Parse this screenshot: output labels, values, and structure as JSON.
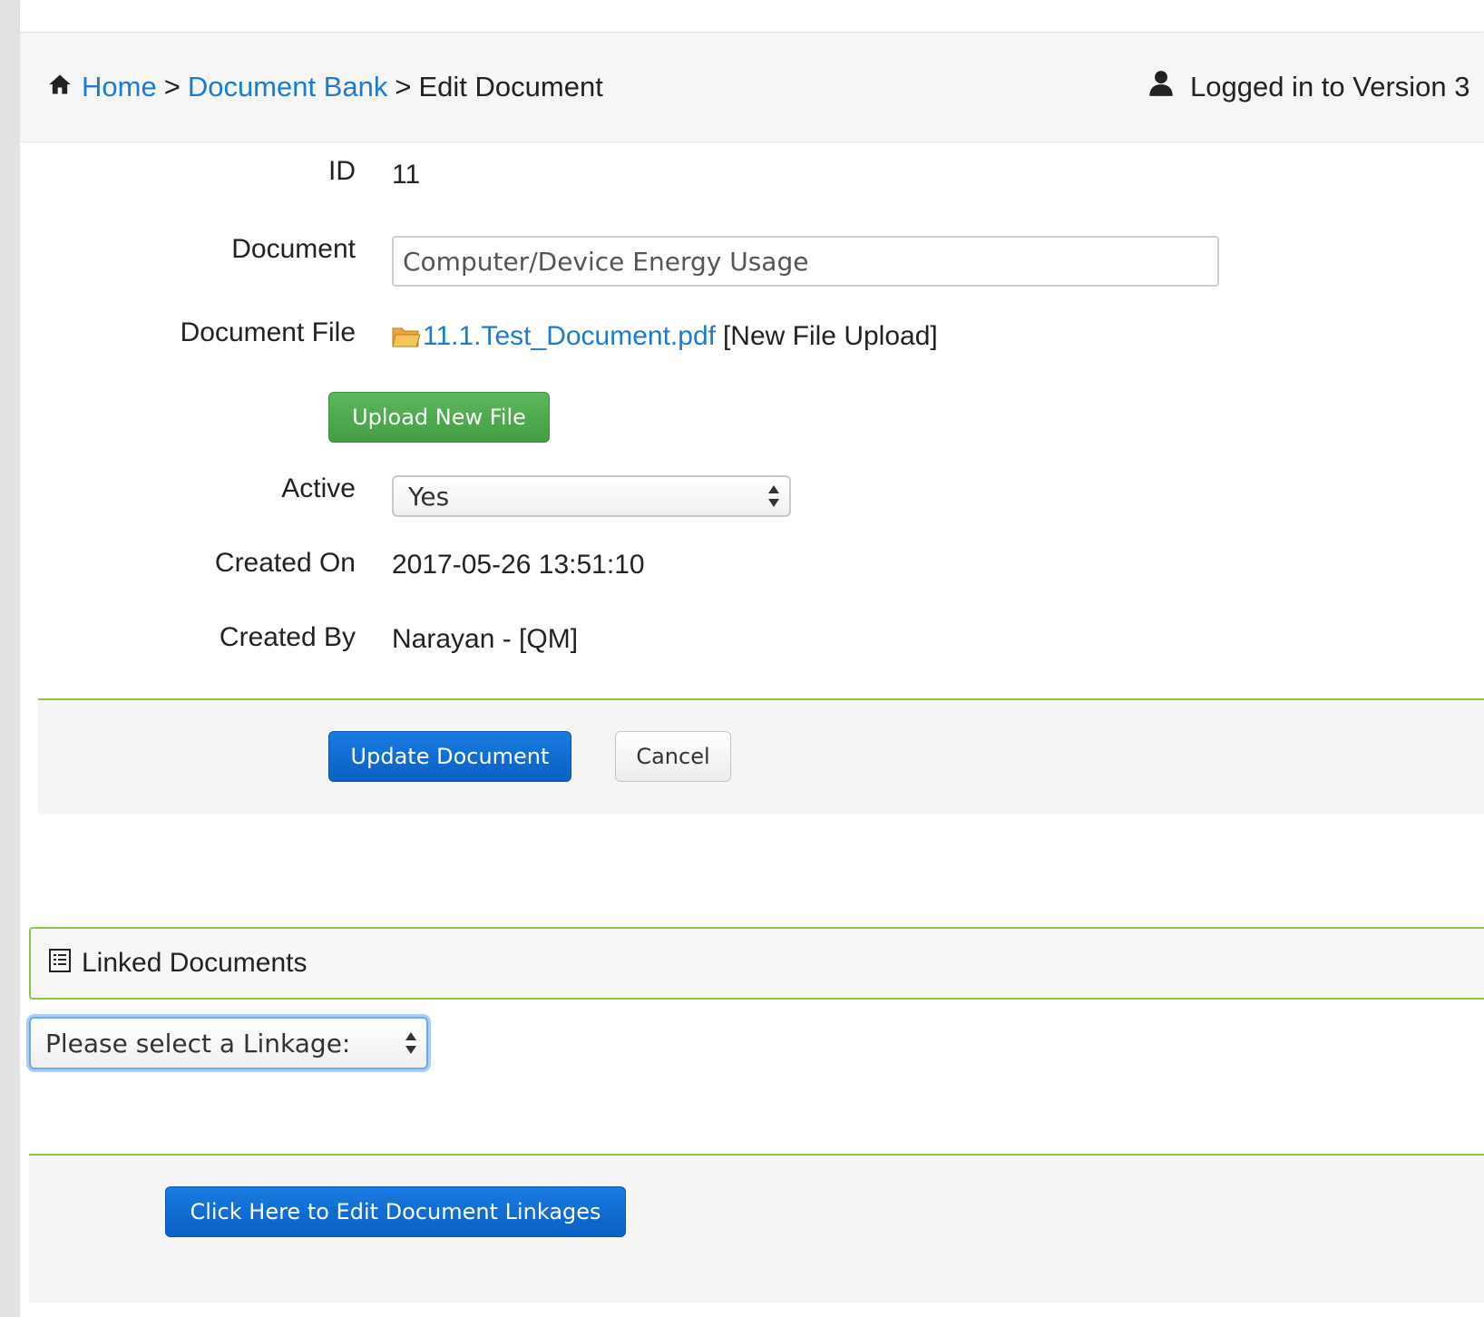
{
  "breadcrumb": {
    "home": "Home",
    "separator": ">",
    "document_bank": "Document Bank",
    "current": "Edit Document"
  },
  "login_status": "Logged in to Version 3",
  "form": {
    "id_label": "ID",
    "id_value": "11",
    "document_label": "Document",
    "document_value": "Computer/Device Energy Usage",
    "document_file_label": "Document File",
    "document_file_link": "11.1.Test_Document.pdf",
    "new_file_upload": "[New File Upload]",
    "upload_button": "Upload New File",
    "active_label": "Active",
    "active_value": "Yes",
    "created_on_label": "Created On",
    "created_on_value": "2017-05-26 13:51:10",
    "created_by_label": "Created By",
    "created_by_value": "Narayan - [QM]"
  },
  "actions": {
    "update": "Update Document",
    "cancel": "Cancel"
  },
  "linked_documents": {
    "title": "Linked Documents",
    "select_placeholder": "Please select a Linkage:",
    "edit_button": "Click Here to Edit Document Linkages"
  },
  "icons": {
    "home": "home-icon",
    "user": "user-icon",
    "folder": "folder-icon",
    "list": "list-icon",
    "select_arrows": "updown-arrows-icon"
  },
  "colors": {
    "link": "#1b7bd3",
    "green_button": "#5cb85c",
    "blue_button": "#0a66cc",
    "accent_border": "#8cc63f"
  }
}
